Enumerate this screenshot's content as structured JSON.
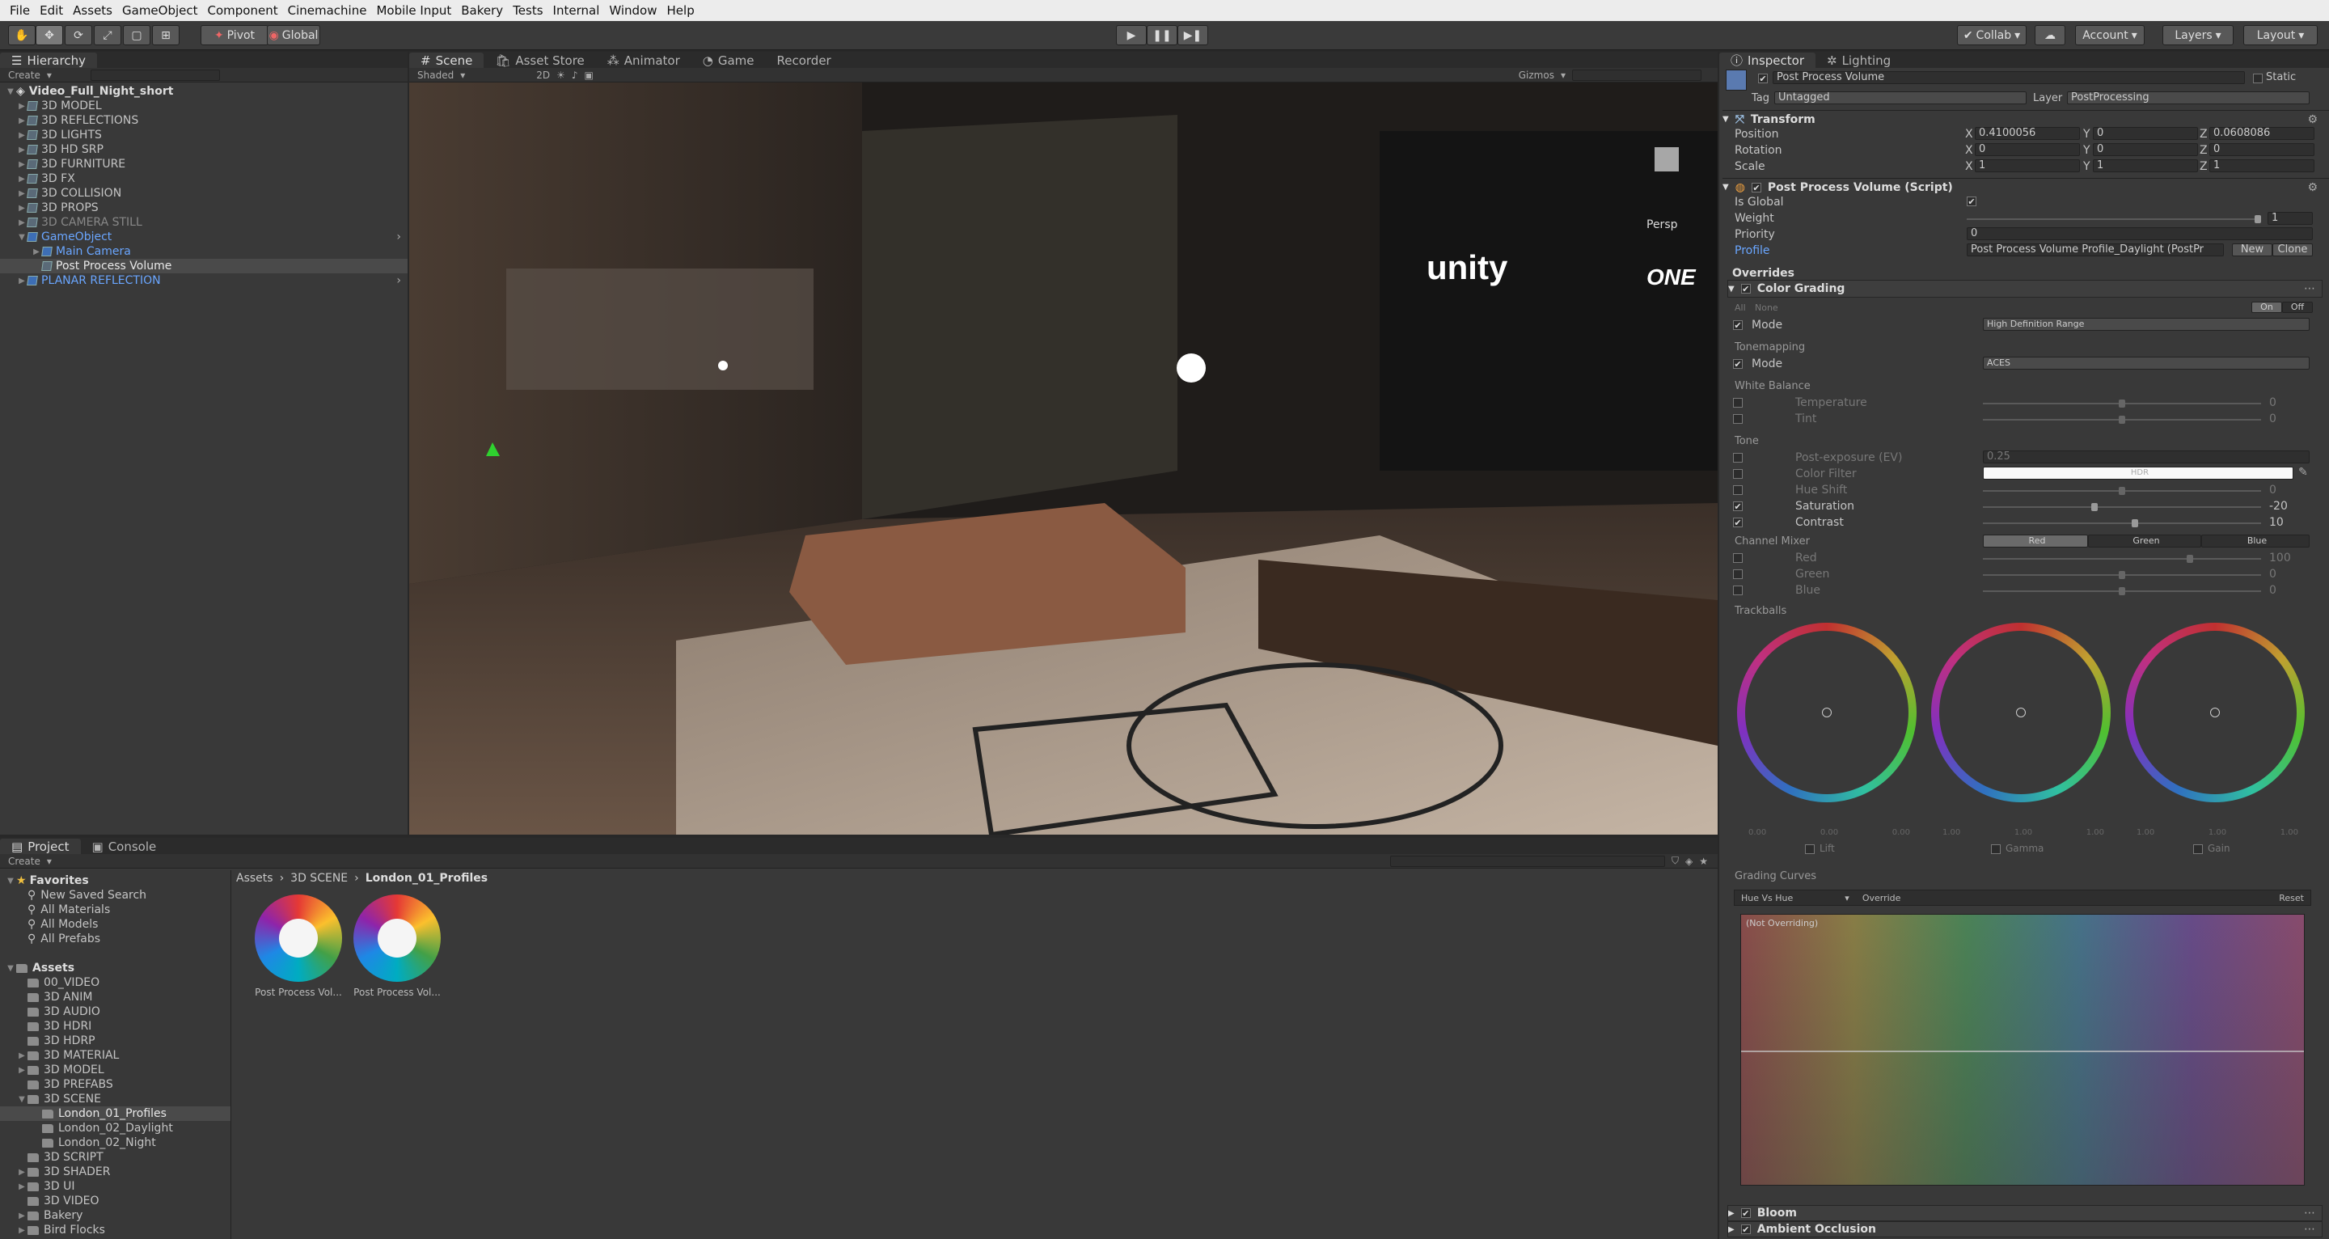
{
  "menu": [
    "File",
    "Edit",
    "Assets",
    "GameObject",
    "Component",
    "Cinemachine",
    "Mobile Input",
    "Bakery",
    "Tests",
    "Internal",
    "Window",
    "Help"
  ],
  "toolbar": {
    "pivot": "Pivot",
    "global": "Global",
    "collab": "Collab",
    "account": "Account",
    "layers": "Layers",
    "layout": "Layout"
  },
  "hierarchy": {
    "tab": "Hierarchy",
    "create": "Create",
    "scene": "Video_Full_Night_short",
    "items": [
      "3D MODEL",
      "3D REFLECTIONS",
      "3D LIGHTS",
      "3D HD SRP",
      "3D FURNITURE",
      "3D FX",
      "3D COLLISION",
      "3D PROPS",
      "3D CAMERA STILL",
      "GameObject",
      "Main Camera",
      "Post Process Volume",
      "PLANAR REFLECTION"
    ]
  },
  "scene": {
    "tabs": [
      "Scene",
      "Asset Store",
      "Animator",
      "Game",
      "Recorder"
    ],
    "shading": "Shaded",
    "mode2d": "2D",
    "gizmos": "Gizmos",
    "persp": "Persp",
    "sign_brand": "unity",
    "sign_brand2": "ONE"
  },
  "project": {
    "tabs": [
      "Project",
      "Console"
    ],
    "create": "Create",
    "breadcrumb": [
      "Assets",
      "3D SCENE",
      "London_01_Profiles"
    ],
    "favorites": "Favorites",
    "fav_items": [
      "New Saved Search",
      "All Materials",
      "All Models",
      "All Prefabs"
    ],
    "assets_label": "Assets",
    "folders": [
      "00_VIDEO",
      "3D ANIM",
      "3D AUDIO",
      "3D HDRI",
      "3D HDRP",
      "3D MATERIAL",
      "3D MODEL",
      "3D PREFABS",
      "3D SCENE",
      "London_01_Profiles",
      "London_02_Daylight",
      "London_02_Night",
      "3D SCRIPT",
      "3D SHADER",
      "3D UI",
      "3D VIDEO",
      "Bakery",
      "Bird Flocks"
    ],
    "asset_items": [
      "Post Process Vol...",
      "Post Process Vol..."
    ]
  },
  "inspector": {
    "tabs": [
      "Inspector",
      "Lighting"
    ],
    "object_name": "Post Process Volume",
    "static": "Static",
    "tag_label": "Tag",
    "tag": "Untagged",
    "layer_label": "Layer",
    "layer": "PostProcessing",
    "transform": {
      "title": "Transform",
      "rows": [
        {
          "label": "Position",
          "x": "0.4100056",
          "y": "0",
          "z": "0.0608086"
        },
        {
          "label": "Rotation",
          "x": "0",
          "y": "0",
          "z": "0"
        },
        {
          "label": "Scale",
          "x": "1",
          "y": "1",
          "z": "1"
        }
      ]
    },
    "ppv": {
      "title": "Post Process Volume (Script)",
      "is_global": "Is Global",
      "weight": "Weight",
      "weight_val": "1",
      "priority": "Priority",
      "priority_val": "0",
      "profile": "Profile",
      "profile_val": "Post Process Volume Profile_Daylight (PostPr",
      "new_btn": "New",
      "clone_btn": "Clone"
    },
    "overrides": "Overrides",
    "color_grading": "Color Grading",
    "all": "All",
    "none": "None",
    "on": "On",
    "off": "Off",
    "mode_label": "Mode",
    "mode_val": "High Definition Range",
    "tonemapping": "Tonemapping",
    "tone_mode": "ACES",
    "white_balance": "White Balance",
    "temperature": "Temperature",
    "temp_val": "0",
    "tint": "Tint",
    "tint_val": "0",
    "tone": "Tone",
    "post_exposure": "Post-exposure (EV)",
    "post_exposure_val": "0.25",
    "color_filter": "Color Filter",
    "hdr": "HDR",
    "hue_shift": "Hue Shift",
    "hue_val": "0",
    "saturation": "Saturation",
    "sat_val": "-20",
    "contrast": "Contrast",
    "con_val": "10",
    "channel_mixer": "Channel Mixer",
    "ch_tabs": [
      "Red",
      "Green",
      "Blue"
    ],
    "red": "Red",
    "red_val": "100",
    "green": "Green",
    "green_val": "0",
    "blue": "Blue",
    "blue_val": "0",
    "trackballs": "Trackballs",
    "wheels": [
      {
        "name": "Lift",
        "vals": [
          "0.00",
          "0.00",
          "0.00"
        ]
      },
      {
        "name": "Gamma",
        "vals": [
          "1.00",
          "1.00",
          "1.00"
        ]
      },
      {
        "name": "Gain",
        "vals": [
          "1.00",
          "1.00",
          "1.00"
        ]
      }
    ],
    "grading_curves": "Grading Curves",
    "curve_select": "Hue Vs Hue",
    "override": "Override",
    "reset": "Reset",
    "not_overriding": "(Not Overriding)",
    "bloom": "Bloom",
    "ao": "Ambient Occlusion"
  },
  "colors": {
    "accent": "#3d6eb5",
    "link": "#6aa6ff",
    "bg": "#393939"
  }
}
